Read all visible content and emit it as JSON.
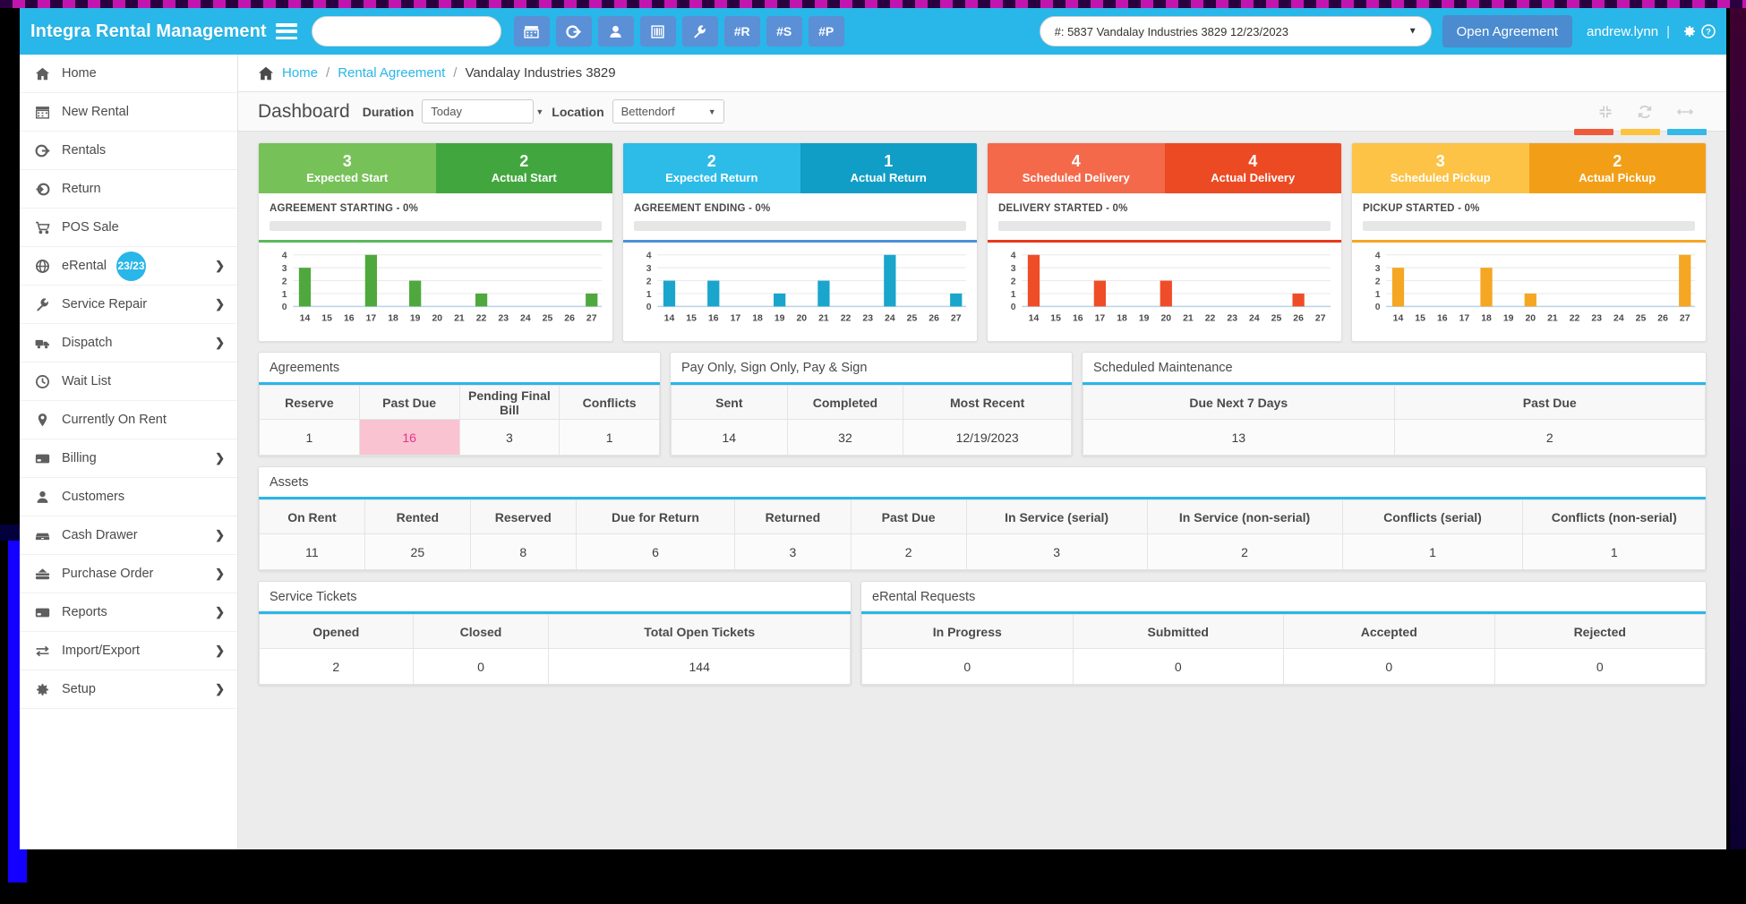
{
  "header": {
    "brand": "Integra Rental Management",
    "search_placeholder": "",
    "search_value": "",
    "tool_buttons": [
      {
        "name": "calendar-icon",
        "label": ""
      },
      {
        "name": "rental-out-icon",
        "label": ""
      },
      {
        "name": "customer-icon",
        "label": ""
      },
      {
        "name": "barcode-icon",
        "label": ""
      },
      {
        "name": "wrench-icon",
        "label": ""
      },
      {
        "name": "hash-r",
        "label": "#R"
      },
      {
        "name": "hash-s",
        "label": "#S"
      },
      {
        "name": "hash-p",
        "label": "#P"
      }
    ],
    "agreement_selected": "#: 5837 Vandalay Industries 3829 12/23/2023",
    "open_agreement_label": "Open Agreement",
    "username": "andrew.lynn",
    "divider": "|"
  },
  "sidebar": {
    "items": [
      {
        "label": "Home",
        "icon": "home-icon",
        "badge": null,
        "chevron": false
      },
      {
        "label": "New Rental",
        "icon": "calendar-icon",
        "badge": null,
        "chevron": false
      },
      {
        "label": "Rentals",
        "icon": "rental-out-icon",
        "badge": null,
        "chevron": false
      },
      {
        "label": "Return",
        "icon": "return-icon",
        "badge": null,
        "chevron": false
      },
      {
        "label": "POS Sale",
        "icon": "cart-icon",
        "badge": null,
        "chevron": false
      },
      {
        "label": "eRental",
        "icon": "globe-icon",
        "badge": "23/23",
        "chevron": true
      },
      {
        "label": "Service Repair",
        "icon": "wrench-icon",
        "badge": null,
        "chevron": true
      },
      {
        "label": "Dispatch",
        "icon": "truck-icon",
        "badge": null,
        "chevron": true
      },
      {
        "label": "Wait List",
        "icon": "clock-icon",
        "badge": null,
        "chevron": false
      },
      {
        "label": "Currently On Rent",
        "icon": "pin-icon",
        "badge": null,
        "chevron": false
      },
      {
        "label": "Billing",
        "icon": "card-icon",
        "badge": null,
        "chevron": true
      },
      {
        "label": "Customers",
        "icon": "user-icon",
        "badge": null,
        "chevron": false
      },
      {
        "label": "Cash Drawer",
        "icon": "drawer-icon",
        "badge": null,
        "chevron": true
      },
      {
        "label": "Purchase Order",
        "icon": "inbox-icon",
        "badge": null,
        "chevron": true
      },
      {
        "label": "Reports",
        "icon": "report-icon",
        "badge": null,
        "chevron": true
      },
      {
        "label": "Import/Export",
        "icon": "exchange-icon",
        "badge": null,
        "chevron": true
      },
      {
        "label": "Setup",
        "icon": "gear-icon",
        "badge": null,
        "chevron": true
      }
    ]
  },
  "breadcrumb": {
    "home": "Home",
    "sep": "/",
    "link": "Rental Agreement",
    "current": "Vandalay Industries 3829"
  },
  "dashboard_bar": {
    "title": "Dashboard",
    "duration_label": "Duration",
    "duration_value": "Today",
    "location_label": "Location",
    "location_value": "Bettendorf",
    "legend_colors": [
      "#ef5a3a",
      "#fdc33e",
      "#34b9e8"
    ]
  },
  "kpi_cards": [
    {
      "left_num": "3",
      "left_cap": "Expected Start",
      "left_color": "#77c159",
      "right_num": "2",
      "right_cap": "Actual Start",
      "right_color": "#42a63f",
      "progress_title": "AGREEMENT STARTING - 0%",
      "accent": "#5cb85c",
      "bar_color": "#4fa83d"
    },
    {
      "left_num": "2",
      "left_cap": "Expected Return",
      "left_color": "#2dbbe8",
      "right_num": "1",
      "right_cap": "Actual Return",
      "right_color": "#119ec6",
      "progress_title": "AGREEMENT ENDING - 0%",
      "accent": "#4a90d9",
      "bar_color": "#1aa5cc"
    },
    {
      "left_num": "4",
      "left_cap": "Scheduled Delivery",
      "left_color": "#f4694a",
      "right_num": "4",
      "right_cap": "Actual Delivery",
      "right_color": "#ec4a23",
      "progress_title": "DELIVERY STARTED - 0%",
      "accent": "#e8391b",
      "bar_color": "#ef4d28"
    },
    {
      "left_num": "3",
      "left_cap": "Scheduled Pickup",
      "left_color": "#fcc347",
      "right_num": "2",
      "right_cap": "Actual Pickup",
      "right_color": "#f29f17",
      "progress_title": "PICKUP STARTED - 0%",
      "accent": "#f5a623",
      "bar_color": "#f5a623"
    }
  ],
  "chart_data": [
    {
      "type": "bar",
      "title": "AGREEMENT STARTING - 0%",
      "categories": [
        "14",
        "15",
        "16",
        "17",
        "18",
        "19",
        "20",
        "21",
        "22",
        "23",
        "24",
        "25",
        "26",
        "27"
      ],
      "values": [
        3,
        0,
        0,
        4,
        0,
        2,
        0,
        0,
        1,
        0,
        0,
        0,
        0,
        1
      ],
      "yticks": [
        "0",
        "1",
        "2",
        "3",
        "4"
      ],
      "ylim": [
        0,
        4
      ],
      "xlabel": "",
      "ylabel": "",
      "grid": true,
      "color": "#4fa83d"
    },
    {
      "type": "bar",
      "title": "AGREEMENT ENDING - 0%",
      "categories": [
        "14",
        "15",
        "16",
        "17",
        "18",
        "19",
        "20",
        "21",
        "22",
        "23",
        "24",
        "25",
        "26",
        "27"
      ],
      "values": [
        2,
        0,
        2,
        0,
        0,
        1,
        0,
        2,
        0,
        0,
        4,
        0,
        0,
        1
      ],
      "yticks": [
        "0",
        "1",
        "2",
        "3",
        "4"
      ],
      "ylim": [
        0,
        4
      ],
      "xlabel": "",
      "ylabel": "",
      "grid": true,
      "color": "#1aa5cc"
    },
    {
      "type": "bar",
      "title": "DELIVERY STARTED - 0%",
      "categories": [
        "14",
        "15",
        "16",
        "17",
        "18",
        "19",
        "20",
        "21",
        "22",
        "23",
        "24",
        "25",
        "26",
        "27"
      ],
      "values": [
        4,
        0,
        0,
        2,
        0,
        0,
        2,
        0,
        0,
        0,
        0,
        0,
        1,
        0
      ],
      "yticks": [
        "0",
        "1",
        "2",
        "3",
        "4"
      ],
      "ylim": [
        0,
        4
      ],
      "xlabel": "",
      "ylabel": "",
      "grid": true,
      "color": "#ef4d28"
    },
    {
      "type": "bar",
      "title": "PICKUP STARTED - 0%",
      "categories": [
        "14",
        "15",
        "16",
        "17",
        "18",
        "19",
        "20",
        "21",
        "22",
        "23",
        "24",
        "25",
        "26",
        "27"
      ],
      "values": [
        3,
        0,
        0,
        0,
        3,
        0,
        1,
        0,
        0,
        0,
        0,
        0,
        0,
        4
      ],
      "yticks": [
        "0",
        "1",
        "2",
        "3",
        "4"
      ],
      "ylim": [
        0,
        4
      ],
      "xlabel": "",
      "ylabel": "",
      "grid": true,
      "color": "#f5a623"
    }
  ],
  "panels": {
    "agreements": {
      "title": "Agreements",
      "headers": [
        "Reserve",
        "Past Due",
        "Pending Final Bill",
        "Conflicts"
      ],
      "values": [
        "1",
        "16",
        "3",
        "1"
      ]
    },
    "paysign": {
      "title": "Pay Only, Sign Only, Pay & Sign",
      "headers": [
        "Sent",
        "Completed",
        "Most Recent"
      ],
      "values": [
        "14",
        "32",
        "12/19/2023"
      ]
    },
    "maintenance": {
      "title": "Scheduled Maintenance",
      "headers": [
        "Due Next 7 Days",
        "Past Due"
      ],
      "values": [
        "13",
        "2"
      ]
    },
    "assets": {
      "title": "Assets",
      "headers": [
        "On Rent",
        "Rented",
        "Reserved",
        "Due for Return",
        "Returned",
        "Past Due",
        "In Service (serial)",
        "In Service (non-serial)",
        "Conflicts (serial)",
        "Conflicts (non-serial)"
      ],
      "values": [
        "11",
        "25",
        "8",
        "6",
        "3",
        "2",
        "3",
        "2",
        "1",
        "1"
      ]
    },
    "tickets": {
      "title": "Service Tickets",
      "headers": [
        "Opened",
        "Closed",
        "Total Open Tickets"
      ],
      "values": [
        "2",
        "0",
        "144"
      ]
    },
    "erental": {
      "title": "eRental Requests",
      "headers": [
        "In Progress",
        "Submitted",
        "Accepted",
        "Rejected"
      ],
      "values": [
        "0",
        "0",
        "0",
        "0"
      ]
    }
  }
}
